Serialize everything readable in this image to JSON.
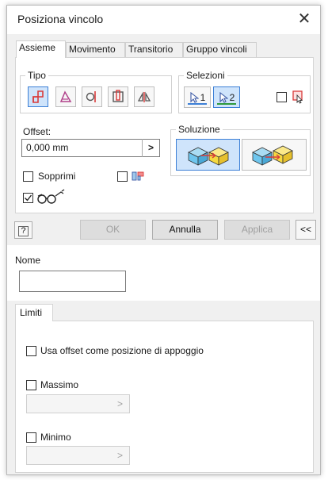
{
  "window": {
    "title": "Posiziona vincolo",
    "close_glyph": "✕"
  },
  "tabs": [
    {
      "label": "Assieme",
      "active": true
    },
    {
      "label": "Movimento",
      "active": false
    },
    {
      "label": "Transitorio",
      "active": false
    },
    {
      "label": "Gruppo vincoli",
      "active": false
    }
  ],
  "tipo": {
    "legend": "Tipo",
    "buttons": [
      {
        "icon": "mate-constraint-icon",
        "selected": true
      },
      {
        "icon": "angle-constraint-icon",
        "selected": false
      },
      {
        "icon": "tangent-constraint-icon",
        "selected": false
      },
      {
        "icon": "insert-constraint-icon",
        "selected": false
      },
      {
        "icon": "symmetry-constraint-icon",
        "selected": false
      }
    ]
  },
  "selezioni": {
    "legend": "Selezioni",
    "select1_label": "1",
    "select2_label": "2",
    "select2_selected": true,
    "first_selection_checked": false
  },
  "offset": {
    "label": "Offset:",
    "value": "0,000 mm",
    "arrow": ">"
  },
  "soluzione": {
    "legend": "Soluzione",
    "selected_index": 0
  },
  "sopprimi": {
    "label": "Sopprimi",
    "checked": false
  },
  "show_preview_checked": false,
  "predict_offset_checked": true,
  "footer": {
    "help": "?",
    "ok": "OK",
    "annulla": "Annulla",
    "applica": "Applica",
    "collapse": "<<"
  },
  "nome": {
    "label": "Nome",
    "value": ""
  },
  "limiti": {
    "tab_label": "Limiti",
    "usa_offset": {
      "label": "Usa offset come posizione di appoggio",
      "checked": false
    },
    "massimo": {
      "label": "Massimo",
      "checked": false,
      "arrow": ">"
    },
    "minimo": {
      "label": "Minimo",
      "checked": false,
      "arrow": ">"
    }
  },
  "colors": {
    "accent": "#3c7fd6",
    "solution_yellow": "#f5d940",
    "solution_blue": "#6ec6ee",
    "arrow_red": "#d93a3a"
  }
}
